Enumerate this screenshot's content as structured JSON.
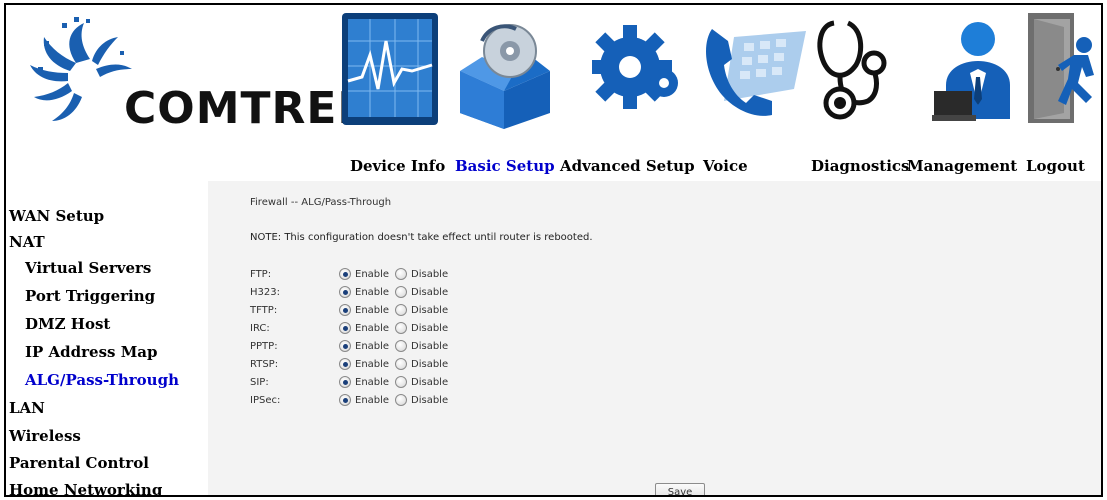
{
  "brand": {
    "logo_text": "COMTREND"
  },
  "nav": [
    {
      "label": "Device Info",
      "icon": "device-info-icon"
    },
    {
      "label": "Basic Setup",
      "icon": "basic-setup-icon",
      "active": true
    },
    {
      "label": "Advanced Setup",
      "icon": "advanced-setup-icon"
    },
    {
      "label": "Voice",
      "icon": "voice-icon"
    },
    {
      "label": "Diagnostics",
      "icon": "diagnostics-icon"
    },
    {
      "label": "Management",
      "icon": "management-icon"
    },
    {
      "label": "Logout",
      "icon": "logout-icon"
    }
  ],
  "sidebar": [
    {
      "label": "WAN Setup"
    },
    {
      "label": "NAT"
    },
    {
      "label": "Virtual Servers",
      "sub": true
    },
    {
      "label": "Port Triggering",
      "sub": true
    },
    {
      "label": "DMZ Host",
      "sub": true
    },
    {
      "label": "IP Address Map",
      "sub": true
    },
    {
      "label": "ALG/Pass-Through",
      "sub": true,
      "active": true
    },
    {
      "label": "LAN"
    },
    {
      "label": "Wireless"
    },
    {
      "label": "Parental Control"
    },
    {
      "label": "Home Networking"
    }
  ],
  "page": {
    "title": "Firewall -- ALG/Pass-Through",
    "note": "NOTE: This configuration doesn't take effect until router is rebooted.",
    "enable_label": "Enable",
    "disable_label": "Disable",
    "save_label": "Save"
  },
  "protocols": [
    {
      "label": "FTP:",
      "value": "Enable"
    },
    {
      "label": "H323:",
      "value": "Enable"
    },
    {
      "label": "TFTP:",
      "value": "Enable"
    },
    {
      "label": "IRC:",
      "value": "Enable"
    },
    {
      "label": "PPTP:",
      "value": "Enable"
    },
    {
      "label": "RTSP:",
      "value": "Enable"
    },
    {
      "label": "SIP:",
      "value": "Enable"
    },
    {
      "label": "IPSec:",
      "value": "Enable"
    }
  ],
  "colors": {
    "active_link": "#0000cc",
    "content_bg": "#f3f3f3"
  }
}
